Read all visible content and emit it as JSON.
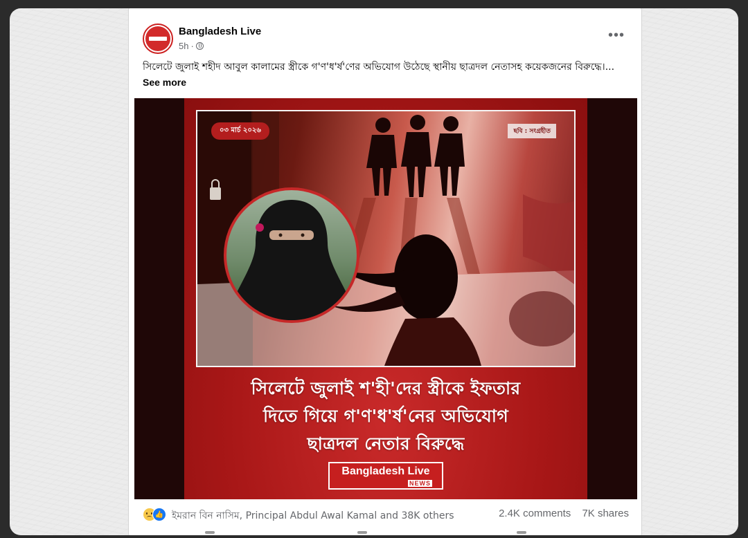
{
  "post": {
    "page_name": "Bangladesh Live",
    "time": "5h",
    "separator": "·",
    "more_label": "•••",
    "text": "সিলেটে জুলাই শহীদ আবুল কালামের স্ত্রীকে গ'ণ'ধ'র্ষ'ণের অভিযোগ উঠেছে স্থানীয় ছাত্রদল নেতাসহ কয়েকজনের বিরুদ্ধে।...",
    "see_more": "See more"
  },
  "image": {
    "date": "০৩ মার্চ ২০২৬",
    "credit": "ছবি : সংগ্রহীত",
    "headline_lines": [
      "সিলেটে জুলাই শ'হী'দের স্ত্রীকে ইফতার",
      "দিতে গিয়ে গ'ণ'ধ'র্ষ'নের অভিযোগ",
      "ছাত্রদল নেতার বিরুদ্ধে"
    ],
    "brand_name": "Bangladesh Live",
    "brand_news": "NEWS"
  },
  "engagement": {
    "reaction_icons": [
      "sad-icon",
      "like-icon"
    ],
    "names": "ইমরান বিন নাসিম, Principal Abdul Awal Kamal and 38K others",
    "comments": "2.4K comments",
    "shares": "7K shares"
  },
  "colors": {
    "poster_red": "#b31e1e",
    "facebook_blue": "#1877f2",
    "text_gray": "#65676b"
  }
}
